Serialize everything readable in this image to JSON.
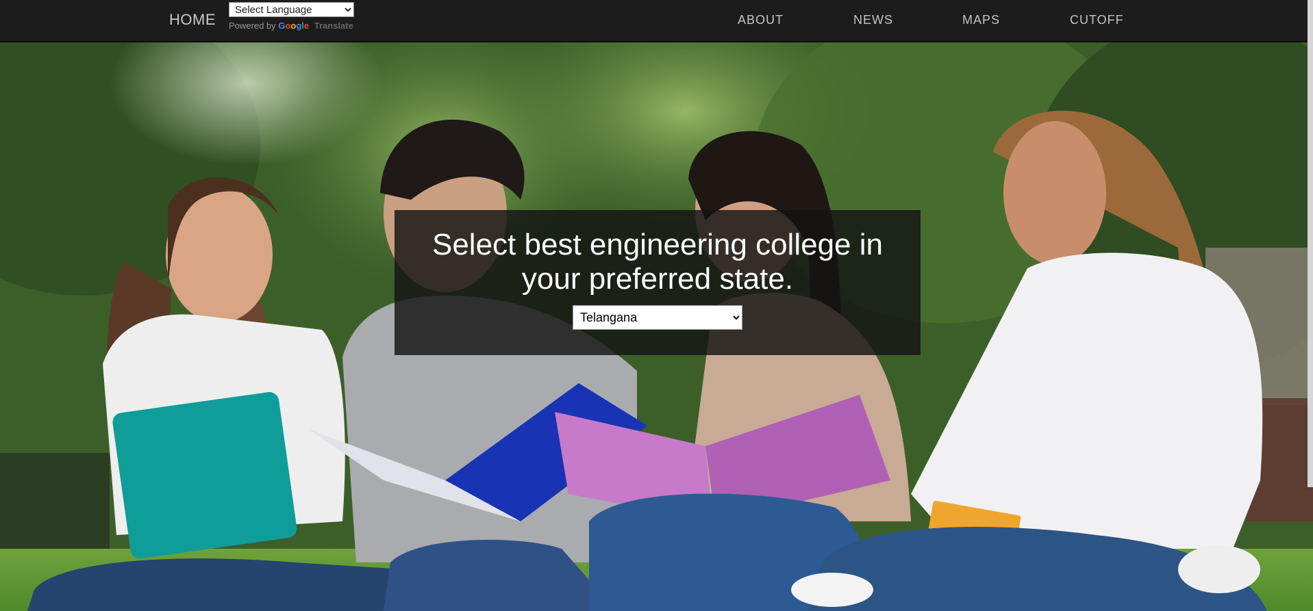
{
  "navbar": {
    "brand": "HOME",
    "language_select": {
      "selected": "Select Language",
      "options": [
        "Select Language"
      ]
    },
    "powered_by": "Powered by",
    "google_logo": "Google",
    "translate_link": "Translate",
    "links": [
      "ABOUT",
      "NEWS",
      "MAPS",
      "CUTOFF"
    ]
  },
  "hero": {
    "headline": "Select best engineering college in your preferred state.",
    "state_select": {
      "selected": "Telangana",
      "options": [
        "Telangana"
      ]
    },
    "image_description_icon": "students-studying-photo"
  },
  "colors": {
    "navbar_bg": "#1c1c1c",
    "nav_text": "#c4c4c4",
    "overlay_bg": "rgba(20,20,20,0.82)",
    "headline_text": "#ffffff"
  }
}
